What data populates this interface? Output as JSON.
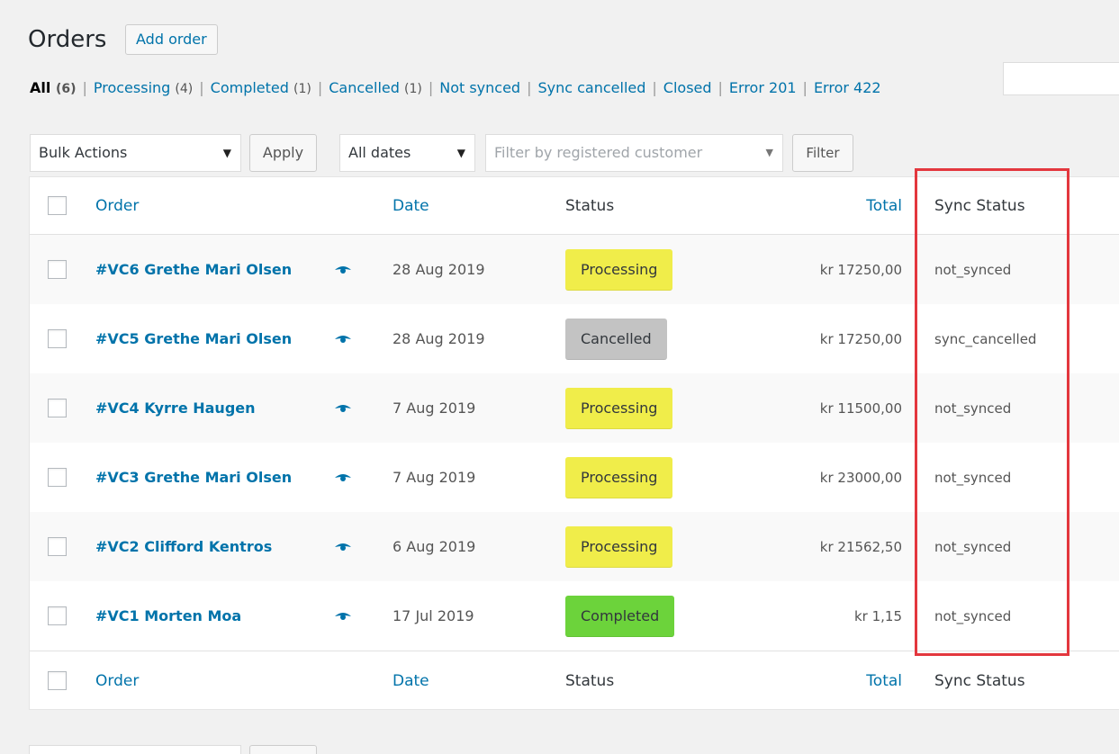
{
  "page": {
    "title": "Orders",
    "add_button": "Add order"
  },
  "views": [
    {
      "label": "All",
      "count": "(6)",
      "current": true
    },
    {
      "label": "Processing",
      "count": "(4)"
    },
    {
      "label": "Completed",
      "count": "(1)"
    },
    {
      "label": "Cancelled",
      "count": "(1)"
    },
    {
      "label": "Not synced",
      "count": ""
    },
    {
      "label": "Sync cancelled",
      "count": ""
    },
    {
      "label": "Closed",
      "count": ""
    },
    {
      "label": "Error 201",
      "count": ""
    },
    {
      "label": "Error 422",
      "count": ""
    }
  ],
  "toolbar": {
    "bulk_actions": "Bulk Actions",
    "apply": "Apply",
    "all_dates": "All dates",
    "customer_placeholder": "Filter by registered customer",
    "filter": "Filter"
  },
  "columns": {
    "order": "Order",
    "date": "Date",
    "status": "Status",
    "total": "Total",
    "sync_status": "Sync Status"
  },
  "status_colors": {
    "Processing": "#f0ed4a",
    "Cancelled": "#c3c3c3",
    "Completed": "#6cd33b"
  },
  "icons": {
    "preview": "eye-icon",
    "dropdown": "triangle-down-icon"
  },
  "orders": [
    {
      "order": "#VC6 Grethe Mari Olsen",
      "date": "28 Aug 2019",
      "status": "Processing",
      "total": "kr 17250,00",
      "sync": "not_synced"
    },
    {
      "order": "#VC5 Grethe Mari Olsen",
      "date": "28 Aug 2019",
      "status": "Cancelled",
      "total": "kr 17250,00",
      "sync": "sync_cancelled"
    },
    {
      "order": "#VC4 Kyrre Haugen",
      "date": "7 Aug 2019",
      "status": "Processing",
      "total": "kr 11500,00",
      "sync": "not_synced"
    },
    {
      "order": "#VC3 Grethe Mari Olsen",
      "date": "7 Aug 2019",
      "status": "Processing",
      "total": "kr 23000,00",
      "sync": "not_synced"
    },
    {
      "order": "#VC2 Clifford Kentros",
      "date": "6 Aug 2019",
      "status": "Processing",
      "total": "kr 21562,50",
      "sync": "not_synced"
    },
    {
      "order": "#VC1 Morten Moa",
      "date": "17 Jul 2019",
      "status": "Completed",
      "total": "kr 1,15",
      "sync": "not_synced"
    }
  ]
}
